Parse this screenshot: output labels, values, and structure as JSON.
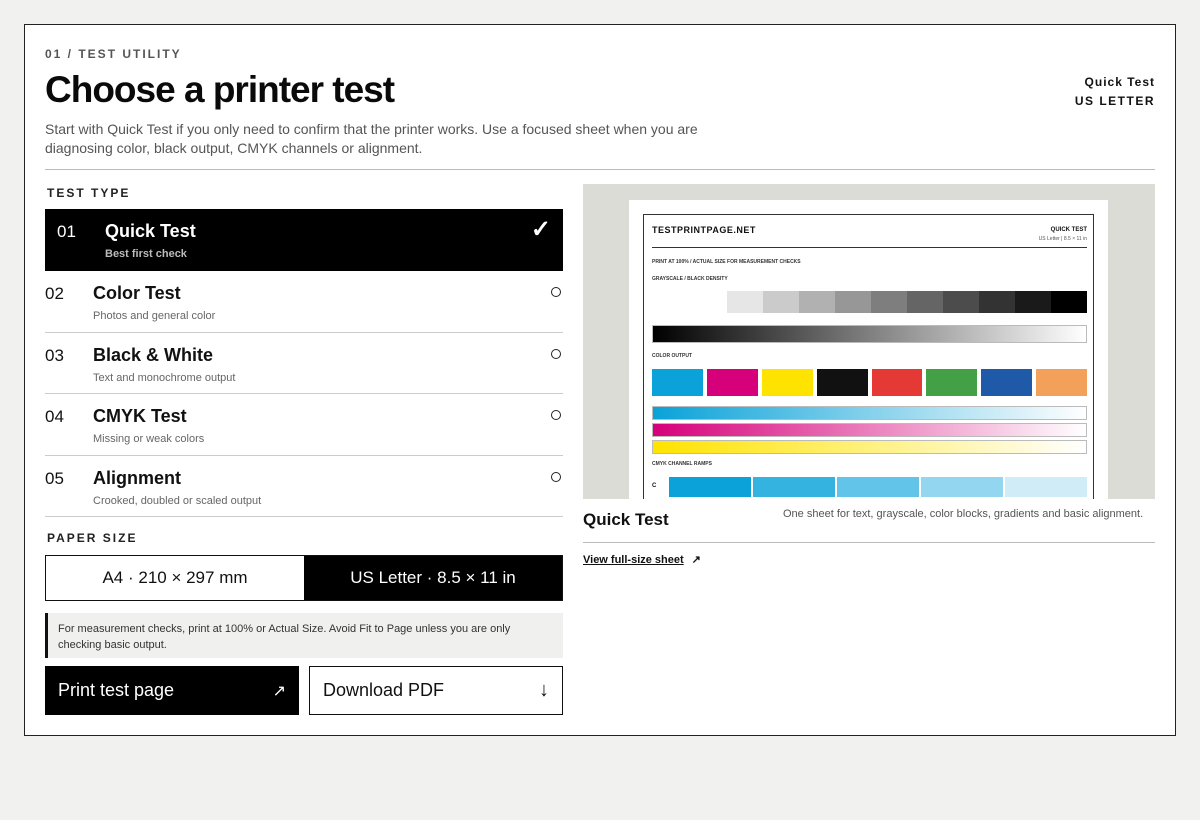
{
  "header": {
    "eyebrow": "01 / TEST UTILITY",
    "title": "Choose a printer test",
    "intro": "Start with Quick Test if you only need to confirm that the printer works. Use a focused sheet when you are diagnosing color, black output, CMYK channels or alignment.",
    "selected_test": "Quick Test",
    "selected_paper": "US LETTER"
  },
  "test_type": {
    "label": "TEST TYPE",
    "items": [
      {
        "num": "01",
        "name": "Quick Test",
        "desc": "Best first check",
        "selected": true
      },
      {
        "num": "02",
        "name": "Color Test",
        "desc": "Photos and general color",
        "selected": false
      },
      {
        "num": "03",
        "name": "Black & White",
        "desc": "Text and monochrome output",
        "selected": false
      },
      {
        "num": "04",
        "name": "CMYK Test",
        "desc": "Missing or weak colors",
        "selected": false
      },
      {
        "num": "05",
        "name": "Alignment",
        "desc": "Crooked, doubled or scaled output",
        "selected": false
      }
    ],
    "check_glyph": "✓"
  },
  "paper_size": {
    "label": "PAPER SIZE",
    "options": [
      {
        "label": "A4 · 210 × 297 mm",
        "selected": false
      },
      {
        "label": "US Letter · 8.5 × 11 in",
        "selected": true
      }
    ]
  },
  "note": "For measurement checks, print at 100% or Actual Size. Avoid Fit to Page unless you are only checking basic output.",
  "actions": {
    "print_label": "Print test page",
    "print_icon": "↗",
    "download_label": "Download PDF",
    "download_icon": "↓"
  },
  "preview": {
    "sheet_title": "TESTPRINTPAGE.NET",
    "sheet_test": "QUICK TEST",
    "sheet_size": "US Letter | 8.5 × 11 in",
    "sheet_print_note": "PRINT AT 100% / ACTUAL SIZE FOR MEASUREMENT CHECKS",
    "sheet_gray_label": "GRAYSCALE / BLACK DENSITY",
    "sheet_color_label": "COLOR OUTPUT",
    "sheet_cmyk_label": "CMYK CHANNEL RAMPS",
    "sheet_c_letter": "C",
    "gray_steps": [
      "#ffffff",
      "#e6e6e6",
      "#cbcbcb",
      "#b1b1b1",
      "#979797",
      "#7e7e7e",
      "#656565",
      "#4c4c4c",
      "#333333",
      "#1a1a1a",
      "#000000"
    ],
    "color_blocks": [
      "#0aa2d8",
      "#d6007a",
      "#ffe300",
      "#111111",
      "#e53935",
      "#43a047",
      "#1e5aa8",
      "#f2a05a"
    ],
    "cyan_ramp": [
      "#0aa2d8",
      "#34b3e0",
      "#62c4e8",
      "#93d6ef",
      "#cfecf7"
    ],
    "title": "Quick Test",
    "description": "One sheet for text, grayscale, color blocks, gradients and basic alignment.",
    "full_link": "View full-size sheet",
    "full_link_icon": "↗"
  }
}
